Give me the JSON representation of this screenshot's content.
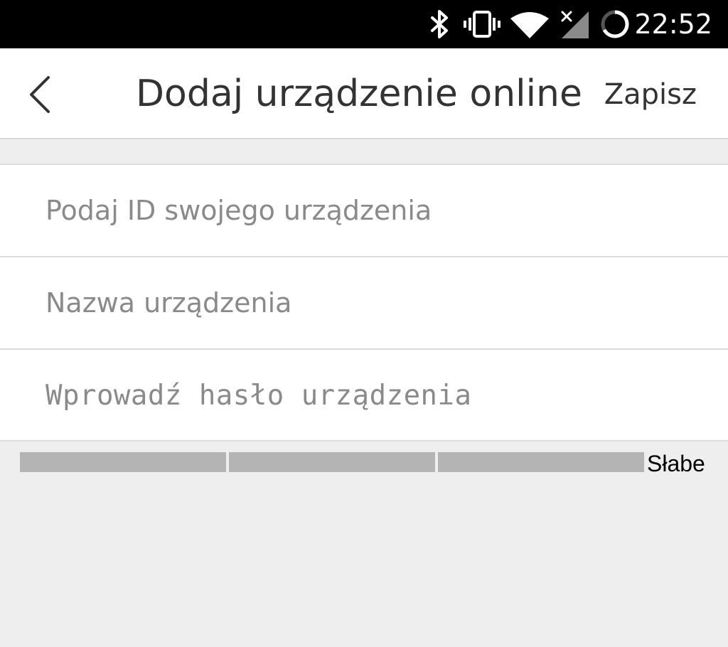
{
  "status_bar": {
    "time": "22:52",
    "icons": [
      "bluetooth-icon",
      "vibrate-icon",
      "wifi-icon",
      "cellular-no-signal-icon",
      "battery-charging-ring-icon"
    ]
  },
  "header": {
    "title": "Dodaj urządzenie online",
    "save_label": "Zapisz",
    "back_icon": "chevron-left-icon"
  },
  "form": {
    "device_id": {
      "value": "",
      "placeholder": "Podaj ID swojego urządzenia"
    },
    "device_name": {
      "value": "",
      "placeholder": "Nazwa urządzenia"
    },
    "device_password": {
      "value": "",
      "placeholder": "Wprowadź hasło urządzenia"
    }
  },
  "password_strength": {
    "label": "Słabe",
    "segments": 3,
    "filled_segments": 0
  },
  "colors": {
    "status_bar_bg": "#000000",
    "surface": "#ffffff",
    "background": "#eeeeee",
    "divider": "#dcdcdc",
    "placeholder": "#8a8a8a",
    "strength_segment": "#b4b4b4"
  }
}
